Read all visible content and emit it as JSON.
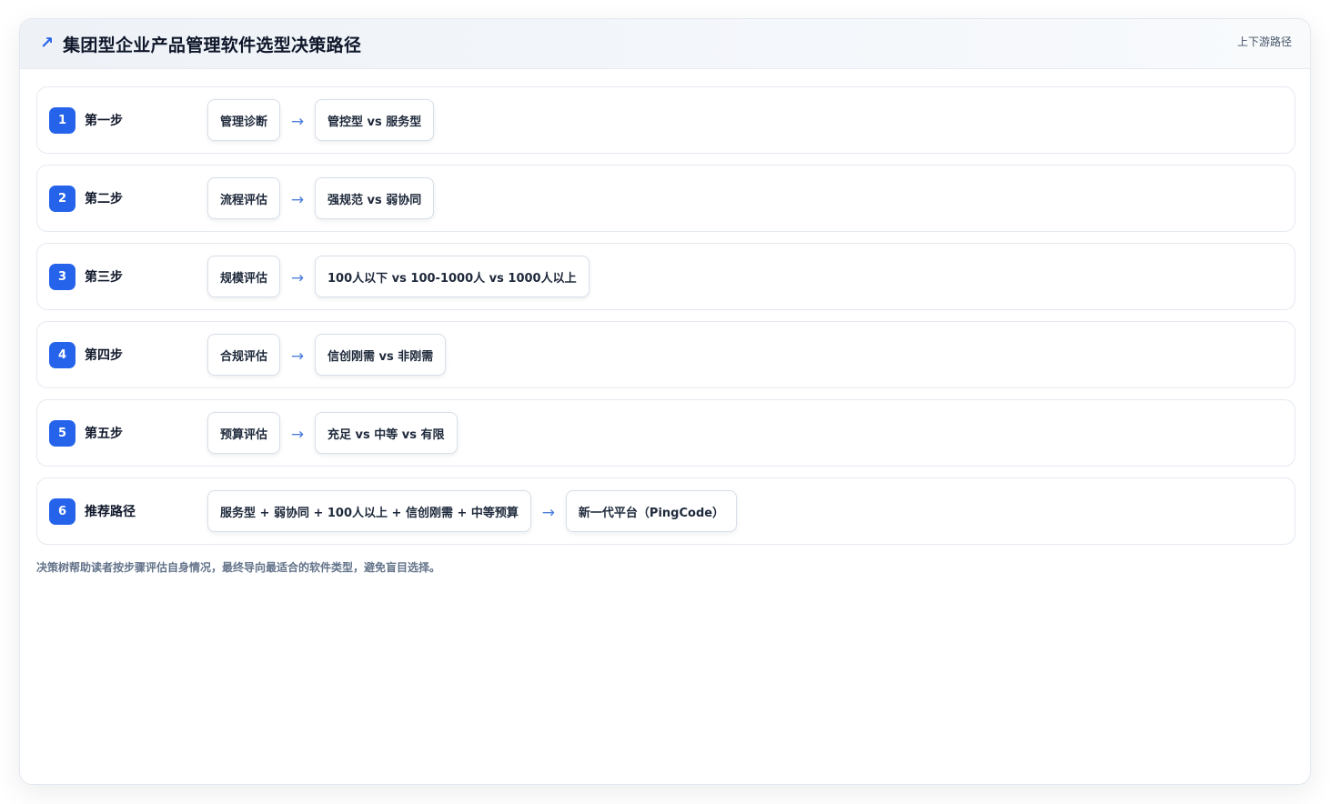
{
  "header": {
    "icon": "trend-arrow-icon",
    "icon_glyph": "↗",
    "title": "集团型企业产品管理软件选型决策路径",
    "tag": "上下游路径"
  },
  "steps": [
    {
      "num": "1",
      "label": "第一步",
      "node_a": "管理诊断",
      "arrow": "→",
      "node_b": "管控型 vs 服务型"
    },
    {
      "num": "2",
      "label": "第二步",
      "node_a": "流程评估",
      "arrow": "→",
      "node_b": "强规范 vs 弱协同"
    },
    {
      "num": "3",
      "label": "第三步",
      "node_a": "规模评估",
      "arrow": "→",
      "node_b": "100人以下 vs 100-1000人 vs 1000人以上"
    },
    {
      "num": "4",
      "label": "第四步",
      "node_a": "合规评估",
      "arrow": "→",
      "node_b": "信创刚需 vs 非刚需"
    },
    {
      "num": "5",
      "label": "第五步",
      "node_a": "预算评估",
      "arrow": "→",
      "node_b": "充足 vs 中等 vs 有限"
    },
    {
      "num": "6",
      "label": "推荐路径",
      "node_a": "服务型 + 弱协同 + 100人以上 + 信创刚需 + 中等预算",
      "arrow": "→",
      "node_b": "新一代平台（PingCode）"
    }
  ],
  "note": "决策树帮助读者按步骤评估自身情况，最终导向最适合的软件类型，避免盲目选择。",
  "colors": {
    "accent": "#2563eb",
    "arrow": "#4f7fdc",
    "border": "#e5eaf1"
  }
}
